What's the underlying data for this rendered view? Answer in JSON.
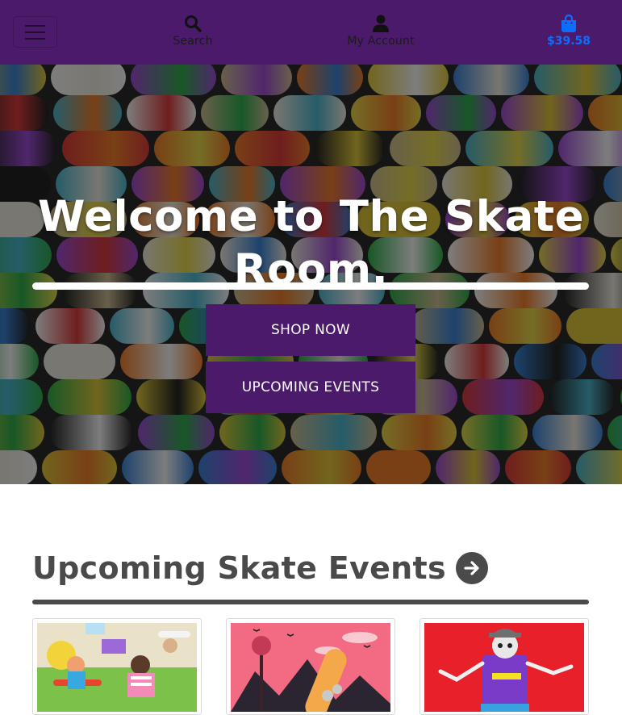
{
  "nav": {
    "search_label": "Search",
    "account_label": "My Account",
    "bag_total": "$39.58"
  },
  "hero": {
    "title": "Welcome to The Skate Room.",
    "shop_label": "SHOP NOW",
    "events_label": "UPCOMING EVENTS"
  },
  "events": {
    "title": "Upcoming Skate Events"
  },
  "colors": {
    "brand_purple": "#4b1a6b",
    "price_blue": "#0d6efd",
    "heading_gray": "#4a4a4a"
  },
  "icons": {
    "menu": "hamburger-icon",
    "search": "search-icon",
    "account": "user-icon",
    "bag": "shopping-bag-icon",
    "section_arrow": "arrow-right-circle-icon"
  }
}
